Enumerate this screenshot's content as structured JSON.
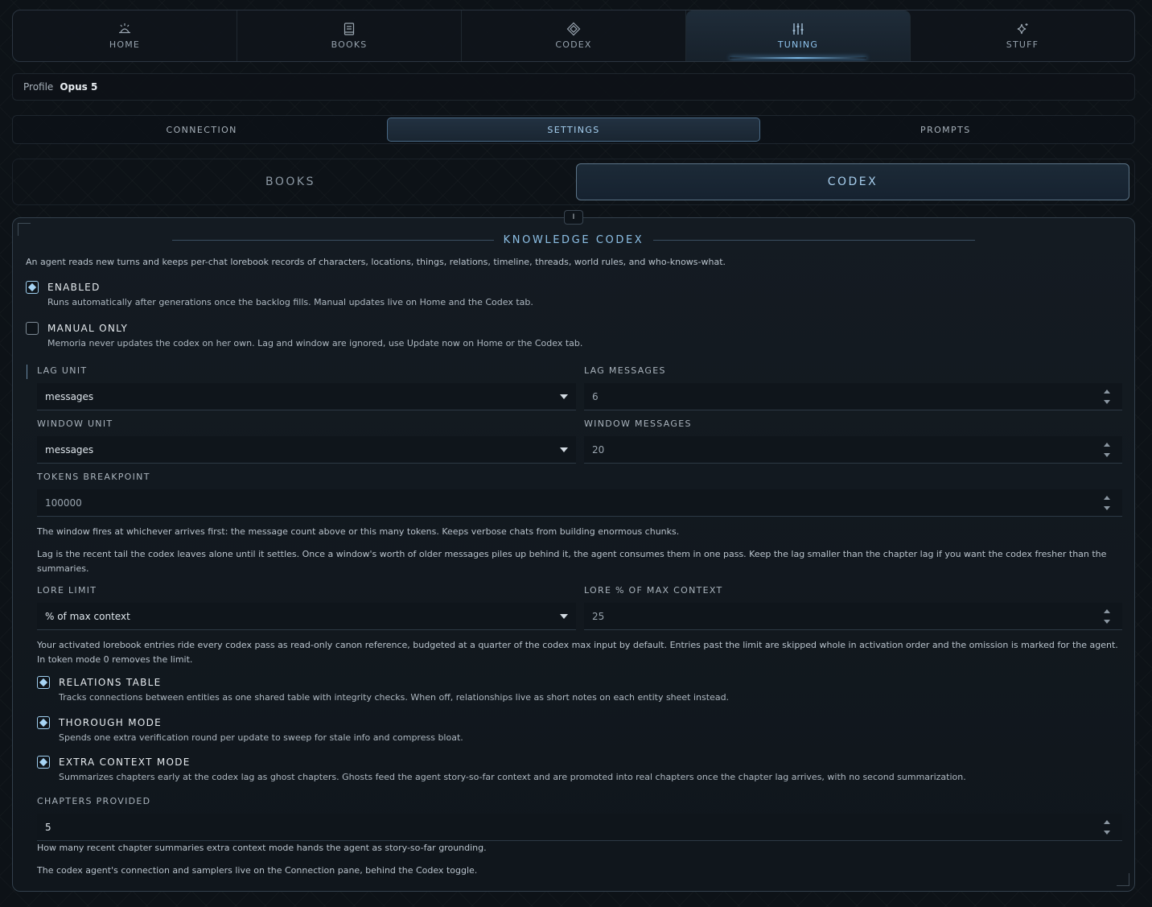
{
  "nav": {
    "tabs": [
      {
        "label": "HOME",
        "icon": "home-sun-icon"
      },
      {
        "label": "BOOKS",
        "icon": "book-icon"
      },
      {
        "label": "CODEX",
        "icon": "diamond-icon"
      },
      {
        "label": "TUNING",
        "icon": "sliders-icon"
      },
      {
        "label": "STUFF",
        "icon": "sparkle-icon"
      }
    ],
    "active": "TUNING"
  },
  "profile": {
    "key": "Profile",
    "value": "Opus 5"
  },
  "subtabs": {
    "items": [
      "CONNECTION",
      "SETTINGS",
      "PROMPTS"
    ],
    "active": "SETTINGS"
  },
  "segment": {
    "items": [
      "BOOKS",
      "CODEX"
    ],
    "active": "CODEX"
  },
  "handle": {
    "label": "I"
  },
  "codex": {
    "title": "KNOWLEDGE CODEX",
    "intro": "An agent reads new turns and keeps per-chat lorebook records of characters, locations, things, relations, timeline, threads, world rules, and who-knows-what.",
    "enabled": {
      "label": "ENABLED",
      "checked": true,
      "desc": "Runs automatically after generations once the backlog fills. Manual updates live on Home and the Codex tab."
    },
    "manual_only": {
      "label": "MANUAL ONLY",
      "checked": false,
      "desc": "Memoria never updates the codex on her own. Lag and window are ignored, use Update now on Home or the Codex tab."
    },
    "lag_unit": {
      "label": "LAG UNIT",
      "value": "messages"
    },
    "lag_messages": {
      "label": "LAG MESSAGES",
      "value": "6"
    },
    "window_unit": {
      "label": "WINDOW UNIT",
      "value": "messages"
    },
    "window_messages": {
      "label": "WINDOW MESSAGES",
      "value": "20"
    },
    "tokens_breakpoint": {
      "label": "TOKENS BREAKPOINT",
      "value": "100000"
    },
    "note_window": "The window fires at whichever arrives first: the message count above or this many tokens. Keeps verbose chats from building enormous chunks.",
    "note_lag": "Lag is the recent tail the codex leaves alone until it settles. Once a window's worth of older messages piles up behind it, the agent consumes them in one pass. Keep the lag smaller than the chapter lag if you want the codex fresher than the summaries.",
    "lore_limit": {
      "label": "LORE LIMIT",
      "value": "% of max context"
    },
    "lore_pct": {
      "label": "LORE % OF MAX CONTEXT",
      "value": "25"
    },
    "note_lore": "Your activated lorebook entries ride every codex pass as read-only canon reference, budgeted at a quarter of the codex max input by default. Entries past the limit are skipped whole in activation order and the omission is marked for the agent. In token mode 0 removes the limit.",
    "relations": {
      "label": "RELATIONS TABLE",
      "checked": true,
      "desc": "Tracks connections between entities as one shared table with integrity checks. When off, relationships live as short notes on each entity sheet instead."
    },
    "thorough": {
      "label": "THOROUGH MODE",
      "checked": true,
      "desc": "Spends one extra verification round per update to sweep for stale info and compress bloat."
    },
    "extra_context": {
      "label": "EXTRA CONTEXT MODE",
      "checked": true,
      "desc": "Summarizes chapters early at the codex lag as ghost chapters. Ghosts feed the agent story-so-far context and are promoted into real chapters once the chapter lag arrives, with no second summarization."
    },
    "chapters_provided": {
      "label": "CHAPTERS PROVIDED",
      "value": "5"
    },
    "note_chapters": "How many recent chapter summaries extra context mode hands the agent as story-so-far grounding.",
    "note_connection": "The codex agent's connection and samplers live on the Connection pane, behind the Codex toggle."
  },
  "colors": {
    "accent": "#8fc4ee",
    "bg": "#0d1217",
    "panel": "#141b22"
  }
}
